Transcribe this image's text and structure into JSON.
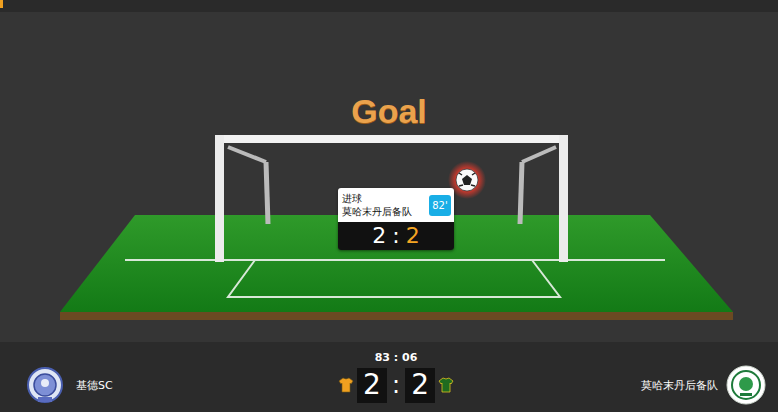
{
  "header": {
    "title": "Goal"
  },
  "event": {
    "label": "进球",
    "team": "莫哈末丹后备队",
    "minute": "82'",
    "score": {
      "home": "2",
      "separator": ":",
      "away": "2",
      "home_highlighted": false,
      "away_highlighted": true
    }
  },
  "match": {
    "clock": "83 : 06",
    "separator": ":",
    "home": {
      "name": "基德SC",
      "score": "2",
      "jersey_color": "#f0a020"
    },
    "away": {
      "name": "莫哈末丹后备队",
      "score": "2",
      "jersey_color": "#1f6b1f"
    }
  }
}
